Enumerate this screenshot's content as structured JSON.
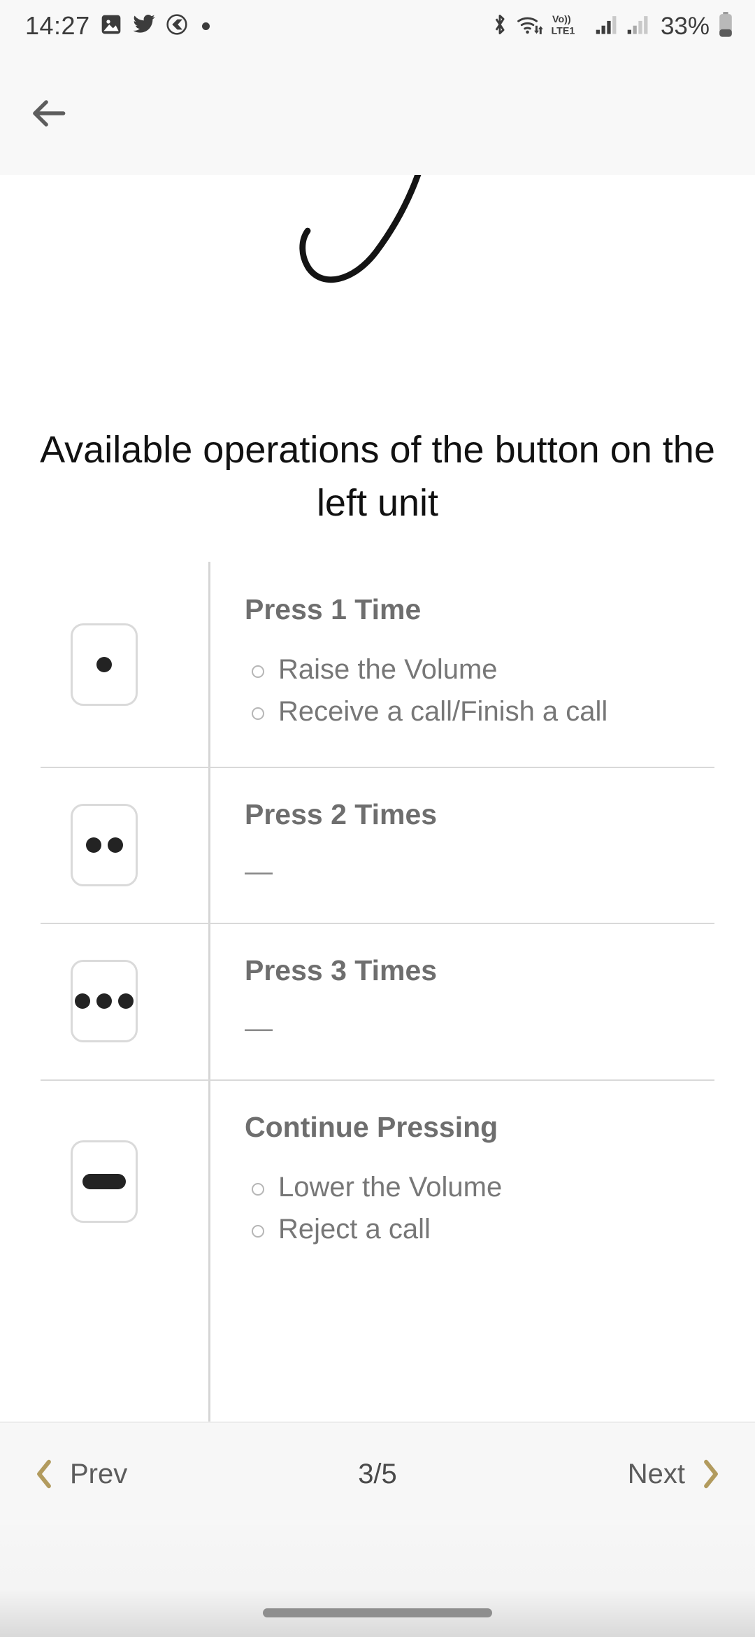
{
  "statusbar": {
    "time": "14:27",
    "battery_percent": "33%",
    "network_label": "Vo))",
    "network_sublabel": "LTE1",
    "left_icons": [
      "gallery-icon",
      "twitter-icon",
      "opera-icon",
      "notification-dot-icon"
    ],
    "right_icons": [
      "bluetooth-icon",
      "wifi-icon",
      "volte-icon",
      "signal-sim1-icon",
      "signal-sim2-icon",
      "battery-icon"
    ]
  },
  "toolbar": {
    "back_label": "Back"
  },
  "hero": {
    "alt": "line drawing of an ear with earbud"
  },
  "page": {
    "title": "Available operations of the button on the left unit"
  },
  "table": {
    "rows": [
      {
        "icon": "one-dot-button-icon",
        "dots": 1,
        "shape": "dots",
        "title": "Press 1 Time",
        "items": [
          "Raise the Volume",
          "Receive a call/Finish a call"
        ],
        "dash": ""
      },
      {
        "icon": "two-dot-button-icon",
        "dots": 2,
        "shape": "dots",
        "title": "Press 2 Times",
        "items": [],
        "dash": "—"
      },
      {
        "icon": "three-dot-button-icon",
        "dots": 3,
        "shape": "dots",
        "title": "Press 3 Times",
        "items": [],
        "dash": "—"
      },
      {
        "icon": "long-press-button-icon",
        "dots": 0,
        "shape": "bar",
        "title": "Continue Pressing",
        "items": [
          "Lower the Volume",
          "Reject a call"
        ],
        "dash": ""
      }
    ]
  },
  "pagenav": {
    "prev_label": "Prev",
    "next_label": "Next",
    "counter": "3/5",
    "current_page": 3,
    "total_pages": 5
  },
  "colors": {
    "accent_gold": "#b29b5e",
    "status_bar_bg": "#f8f8f8",
    "text_primary": "#111111",
    "text_secondary": "#6e6e6e",
    "divider": "#d9d9d9"
  }
}
